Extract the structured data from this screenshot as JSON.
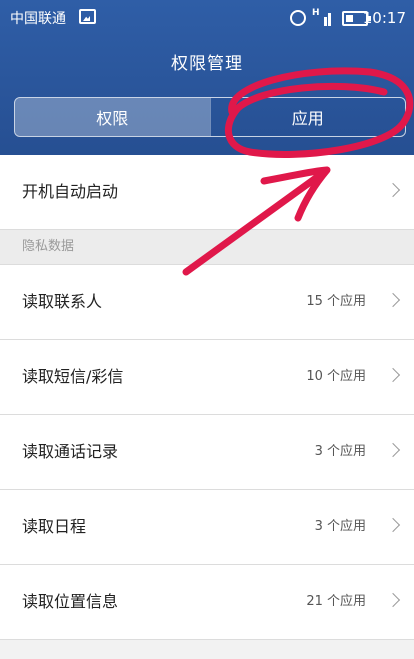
{
  "status_bar": {
    "carrier": "中国联通",
    "time": "10:17",
    "network": "H"
  },
  "header": {
    "title": "权限管理",
    "tabs": [
      {
        "label": "权限",
        "active": true
      },
      {
        "label": "应用",
        "active": false
      }
    ]
  },
  "autostart": {
    "label": "开机自动启动"
  },
  "section_privacy": {
    "label": "隐私数据"
  },
  "items": [
    {
      "label": "读取联系人",
      "count": "15 个应用"
    },
    {
      "label": "读取短信/彩信",
      "count": "10 个应用"
    },
    {
      "label": "读取通话记录",
      "count": "3 个应用"
    },
    {
      "label": "读取日程",
      "count": "3 个应用"
    },
    {
      "label": "读取位置信息",
      "count": "21 个应用"
    }
  ],
  "colors": {
    "header": "#2b579d",
    "annotation": "#e0184a"
  }
}
